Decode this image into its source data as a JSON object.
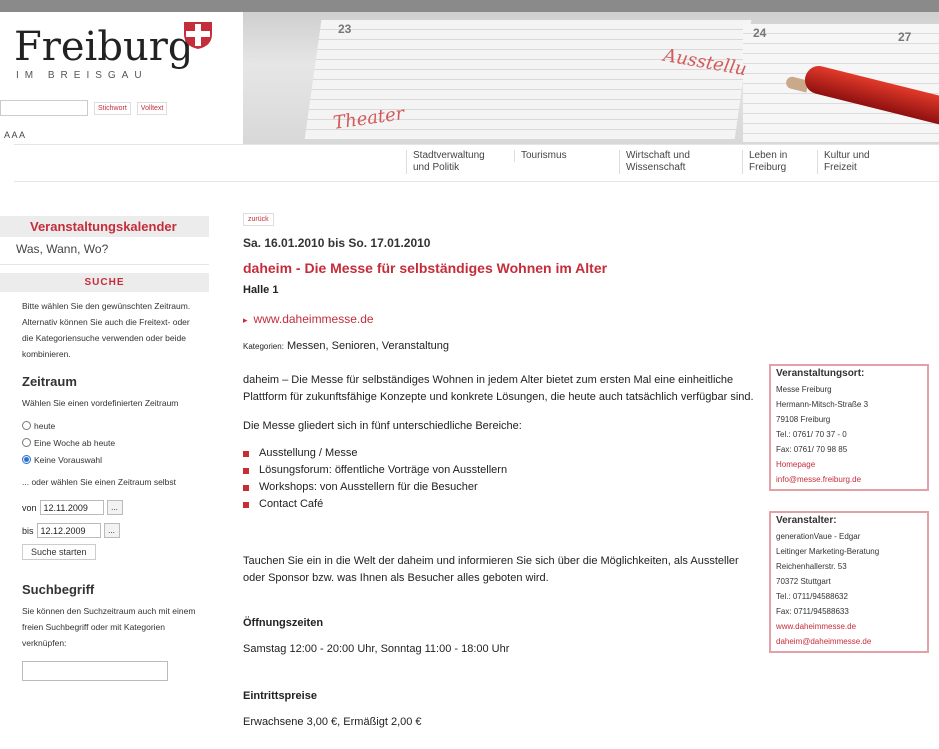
{
  "header": {
    "logo": "Freiburg",
    "logo_sub": "IM BREISGAU",
    "search_btn_stichwort": "Stichwort",
    "search_btn_volltext": "Volltext",
    "font_sizes": "A A A",
    "banner_texts": [
      "23",
      "24",
      "27",
      "Ausstellu",
      "Theater"
    ]
  },
  "nav": [
    {
      "line1": "Stadtverwaltung",
      "line2": "und Politik"
    },
    {
      "line1": "Tourismus",
      "line2": ""
    },
    {
      "line1": "Wirtschaft und",
      "line2": "Wissenschaft"
    },
    {
      "line1": "Leben in",
      "line2": "Freiburg"
    },
    {
      "line1": "Kultur und",
      "line2": "Freizeit"
    }
  ],
  "sidebar": {
    "calendar_title": "Veranstaltungskalender",
    "calendar_sub": "Was, Wann, Wo?",
    "suche": "SUCHE",
    "intro": "Bitte wählen Sie den gewünschten Zeitraum. Alternativ können Sie auch die Freitext- oder die Kategoriensuche verwenden oder beide kombinieren.",
    "zeitraum_h": "Zeitraum",
    "zeitraum_p": "Wählen Sie einen vordefinierten Zeitraum",
    "radio": [
      "heute",
      "Eine Woche ab heute",
      "Keine Vorauswahl"
    ],
    "or_choose": "... oder wählen Sie einen Zeitraum selbst",
    "von_label": "von",
    "von_value": "12.11.2009",
    "bis_label": "bis",
    "bis_value": "12.12.2009",
    "cal_btn": "...",
    "submit": "Suche starten",
    "suchbegriff_h": "Suchbegriff",
    "suchbegriff_p": "Sie können den Suchzeitraum auch mit einem freien Suchbegriff oder mit Kategorien verknüpfen:"
  },
  "main": {
    "back": "zurück",
    "date": "Sa. 16.01.2010 bis So. 17.01.2010",
    "title": "daheim - Die Messe für selbständiges Wohnen im Alter",
    "hall": "Halle 1",
    "link": "www.daheimmesse.de",
    "cats_label": "Kategorien:",
    "cats": "Messen, Senioren, Veranstaltung",
    "para1": "daheim – Die Messe für selbständiges Wohnen in jedem Alter bietet zum ersten Mal eine einheitliche Plattform für zukunftsfähige Konzepte und konkrete Lösungen, die heute auch tatsächlich verfügbar sind.",
    "para2": "Die Messe gliedert sich in fünf unterschiedliche Bereiche:",
    "list": [
      "Ausstellung / Messe",
      "Lösungsforum: öffentliche Vorträge von Ausstellern",
      "Workshops: von Ausstellern für die Besucher",
      "Contact Café"
    ],
    "para3": "Tauchen Sie ein in die Welt der daheim und informieren Sie sich über die Möglichkeiten, als Aussteller oder Sponsor bzw. was Ihnen als Besucher alles geboten wird.",
    "hours_h": "Öffnungszeiten",
    "hours": "Samstag 12:00 - 20:00 Uhr, Sonntag 11:00 - 18:00 Uhr",
    "price_h": "Eintrittspreise",
    "price": "Erwachsene 3,00 €, Ermäßigt 2,00 €"
  },
  "venue": {
    "heading": "Veranstaltungsort:",
    "lines": [
      "Messe Freiburg",
      "Hermann-Mitsch-Straße 3",
      "79108 Freiburg",
      "Tel.: 0761/ 70 37 - 0",
      "Fax: 0761/ 70 98 85"
    ],
    "homepage": "Homepage",
    "email": "info@messe.freiburg.de"
  },
  "organizer": {
    "heading": "Veranstalter:",
    "lines": [
      "generationVaue - Edgar",
      "Leitinger Marketing-Beratung",
      "Reichenhallerstr. 53",
      "70372 Stuttgart",
      "Tel.: 0711/94588632",
      "Fax: 0711/94588633"
    ],
    "web": "www.daheimmesse.de",
    "email": "daheim@daheimmesse.de"
  }
}
